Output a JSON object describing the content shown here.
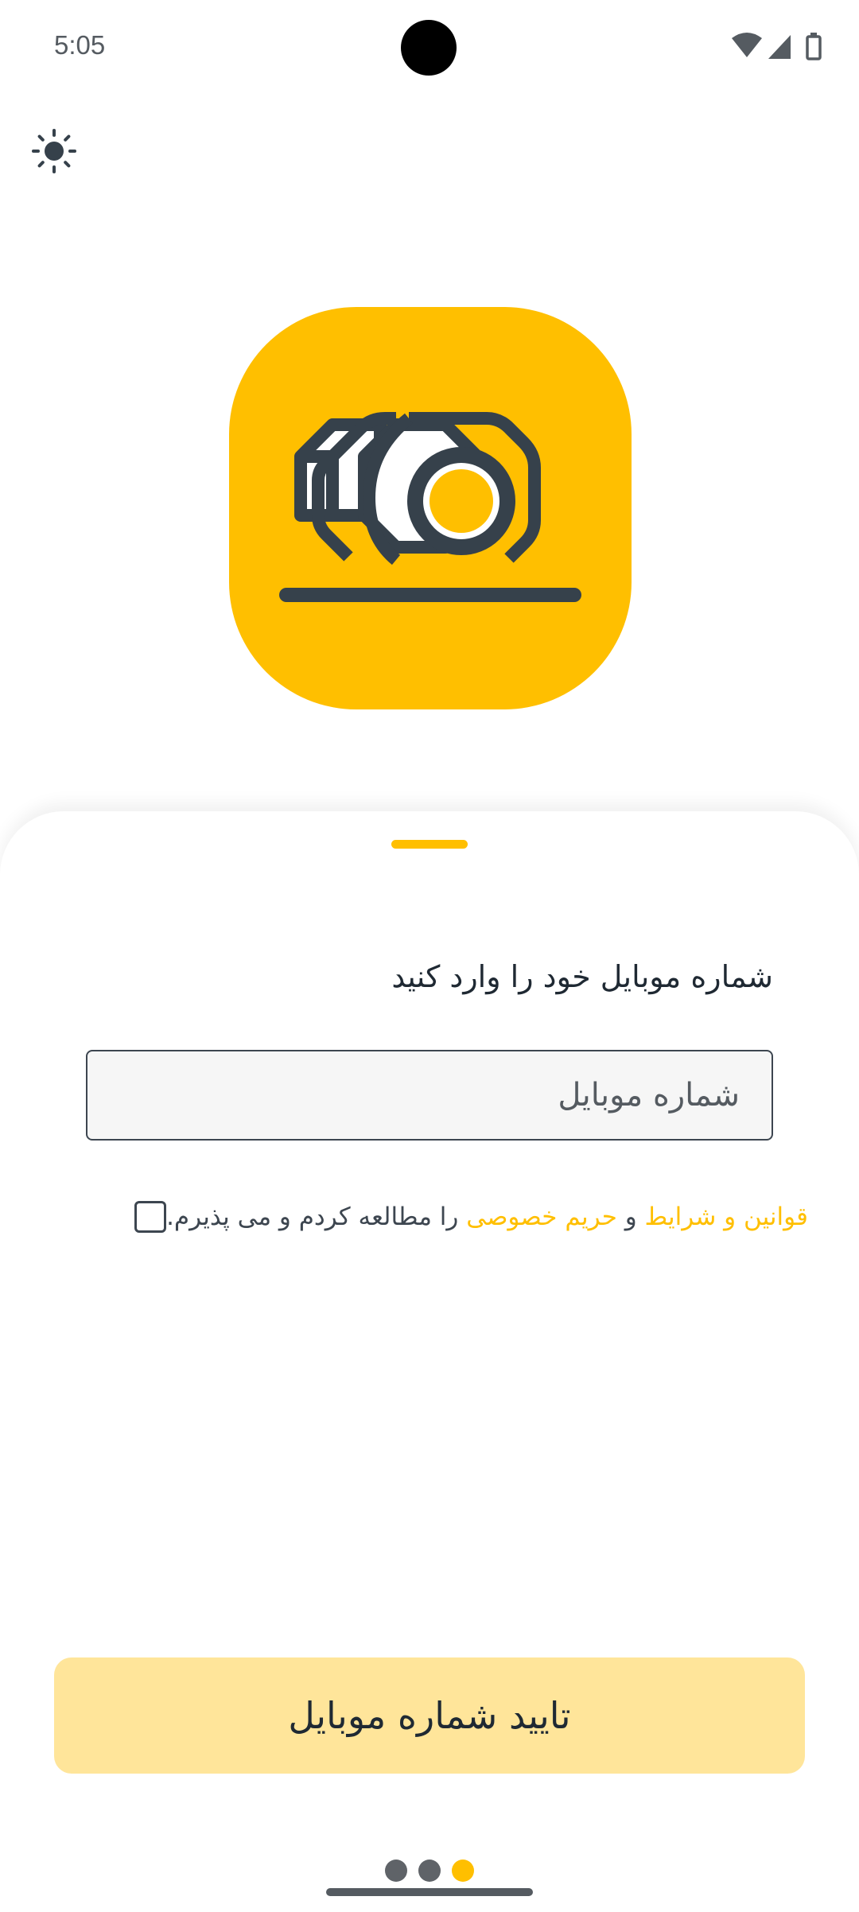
{
  "status_bar": {
    "time": "5:05",
    "icons": [
      "wifi-icon",
      "cellular-signal-icon",
      "battery-icon"
    ]
  },
  "header": {
    "theme_toggle_icon": "sun-icon"
  },
  "logo": {
    "icon": "nut-bolt-icon",
    "background_color": "#ffbf00",
    "stroke_color": "#36414b"
  },
  "login_sheet": {
    "prompt": "شماره موبایل خود را وارد کنید",
    "phone_input": {
      "placeholder": "شماره موبایل",
      "value": ""
    },
    "terms": {
      "checked": false,
      "link_terms": "قوانین و شرایط",
      "conjunction": " و ",
      "link_privacy": "حریم خصوصی",
      "suffix": " را مطالعه کردم و می پذیرم."
    },
    "confirm_button": "تایید شماره موبایل"
  },
  "pager": {
    "dots": [
      {
        "color": "#5f6368",
        "active": false
      },
      {
        "color": "#5f6368",
        "active": false
      },
      {
        "color": "#ffbf00",
        "active": true
      }
    ]
  },
  "colors": {
    "accent": "#ffbf00",
    "button_background": "#ffe59a",
    "text_dark": "#1f2933"
  }
}
